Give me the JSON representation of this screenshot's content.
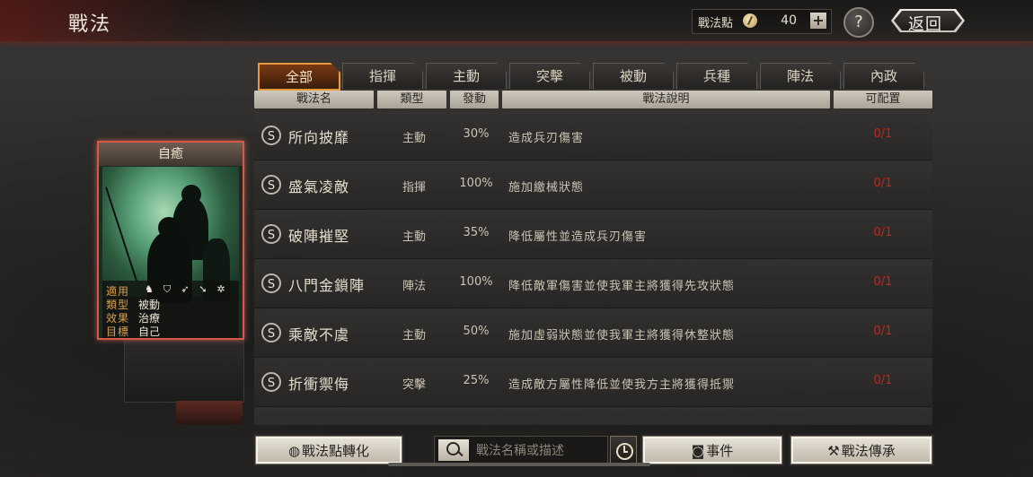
{
  "header": {
    "title": "戰法",
    "points_label": "戰法點",
    "points_value": "40",
    "plus_label": "+",
    "help_label": "?",
    "back_label": "返回"
  },
  "tabs": [
    {
      "label": "全部",
      "active": true
    },
    {
      "label": "指揮",
      "active": false
    },
    {
      "label": "主動",
      "active": false
    },
    {
      "label": "突擊",
      "active": false
    },
    {
      "label": "被動",
      "active": false
    },
    {
      "label": "兵種",
      "active": false
    },
    {
      "label": "陣法",
      "active": false
    },
    {
      "label": "內政",
      "active": false
    }
  ],
  "columns": [
    "戰法名",
    "類型",
    "發動",
    "戰法說明",
    "可配置"
  ],
  "tactics": [
    {
      "grade": "S",
      "name": "所向披靡",
      "type": "主動",
      "rate": "30%",
      "desc": "造成兵刃傷害",
      "count": "0/1"
    },
    {
      "grade": "S",
      "name": "盛氣凌敵",
      "type": "指揮",
      "rate": "100%",
      "desc": "施加繳械狀態",
      "count": "0/1"
    },
    {
      "grade": "S",
      "name": "破陣摧堅",
      "type": "主動",
      "rate": "35%",
      "desc": "降低屬性並造成兵刃傷害",
      "count": "0/1"
    },
    {
      "grade": "S",
      "name": "八門金鎖陣",
      "type": "陣法",
      "rate": "100%",
      "desc": "降低敵軍傷害並使我軍主將獲得先攻狀態",
      "count": "0/1"
    },
    {
      "grade": "S",
      "name": "乘敵不虞",
      "type": "主動",
      "rate": "50%",
      "desc": "施加虛弱狀態並使我軍主將獲得休整狀態",
      "count": "0/1"
    },
    {
      "grade": "S",
      "name": "折衝禦侮",
      "type": "突擊",
      "rate": "25%",
      "desc": "造成敵方屬性降低並使我方主將獲得抵禦",
      "count": "0/1"
    }
  ],
  "card": {
    "title": "自癒",
    "applicable_key": "適用",
    "type_key": "類型",
    "type_value": "被動",
    "effect_key": "效果",
    "effect_value": "治療",
    "target_key": "目標",
    "target_value": "自己",
    "troop_icons": [
      "cavalry-icon",
      "shield-icon",
      "bow-icon",
      "spear-icon",
      "wheel-icon"
    ]
  },
  "bottom": {
    "convert_label": "戰法點轉化",
    "search_placeholder": "戰法名稱或描述",
    "events_label": "事件",
    "inherit_label": "戰法傳承"
  },
  "colors": {
    "accent_tab": "#e59b3b",
    "count_red": "#c0261c",
    "card_border": "#d8574a"
  }
}
